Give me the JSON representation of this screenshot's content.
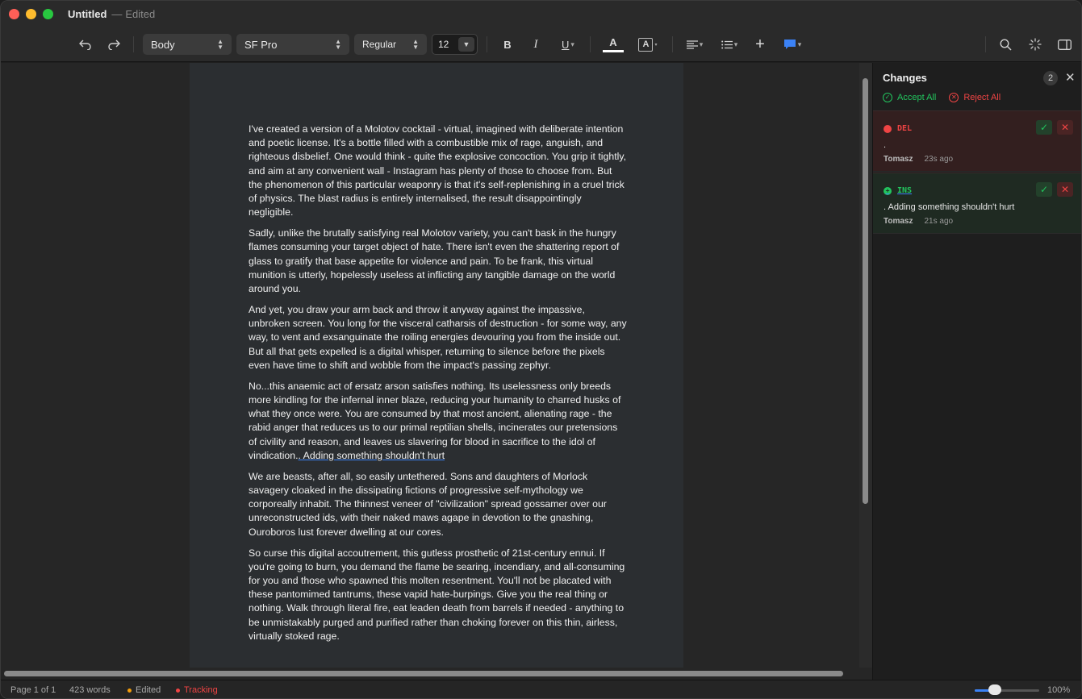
{
  "window": {
    "title": "Untitled",
    "separator": "—",
    "subtitle": "Edited"
  },
  "toolbar": {
    "style_select": "Body",
    "font_select": "SF Pro",
    "weight_select": "Regular",
    "size_value": "12",
    "bold_label": "B",
    "italic_label": "I",
    "underline_label": "U",
    "text_color_label": "A",
    "highlight_label": "A"
  },
  "document": {
    "paragraphs": [
      "I've created a version of a Molotov cocktail - virtual, imagined with deliberate intention and poetic license. It's a bottle filled with a combustible mix of rage, anguish, and righteous disbelief. One would think - quite the explosive concoction. You grip it tightly, and aim at any convenient wall - Instagram has plenty of those to choose from. But the phenomenon of this particular weaponry is that it's self-replenishing in a cruel trick of physics. The blast radius is entirely internalised, the result disappointingly negligible.",
      "Sadly, unlike the brutally satisfying real Molotov variety, you can't bask in the hungry flames consuming your target object of hate. There isn't even the shattering report of glass to gratify that base appetite for violence and pain. To be frank, this virtual munition is utterly, hopelessly useless at inflicting any tangible damage on the world around you.",
      "And yet, you draw your arm back and throw it anyway against the impassive, unbroken screen. You long for the visceral catharsis of destruction - for some way, any way, to vent and exsanguinate the roiling energies devouring you from the inside out. But all that gets expelled is a digital whisper, returning to silence before the pixels even have time to shift and wobble from the impact's passing zephyr.",
      "No...this anaemic act of ersatz arson satisfies nothing. Its uselessness only breeds more kindling for the infernal inner blaze, reducing your humanity to charred husks of what they once were. You are consumed by that most ancient, alienating rage - the rabid anger that reduces us to our primal reptilian shells, incinerates our pretensions of civility and reason, and leaves us slavering for blood in sacrifice to the idol of vindication.",
      "We are beasts, after all, so easily untethered. Sons and daughters of Morlock savagery cloaked in the dissipating fictions of progressive self-mythology we corporeally inhabit. The thinnest veneer of \"civilization\" spread gossamer over our unreconstructed ids, with their naked maws agape in devotion to the gnashing, Ouroboros lust forever dwelling at our cores.",
      "So curse this digital accoutrement, this gutless prosthetic of 21st-century ennui. If you're going to burn, you demand the flame be searing, incendiary, and all-consuming for you and those who spawned this molten resentment. You'll not be placated with these pantomimed tantrums, these vapid hate-burpings. Give you the real thing or nothing. Walk through literal fire, eat leaden death from barrels if needed - anything to be unmistakably purged and purified rather than choking forever on this thin, airless, virtually stoked rage."
    ],
    "inserted_text": ". Adding something shouldn't hurt"
  },
  "sidebar": {
    "title": "Changes",
    "count": "2",
    "close_glyph": "✕",
    "accept_all": "Accept All",
    "reject_all": "Reject All",
    "changes": [
      {
        "kind": "DEL",
        "text": ".",
        "author": "Tomasz",
        "time": "23s ago"
      },
      {
        "kind": "INS",
        "text": ". Adding something shouldn't hurt",
        "author": "Tomasz",
        "time": "21s ago"
      }
    ]
  },
  "status": {
    "page": "Page 1 of 1",
    "words": "423 words",
    "edited": "Edited",
    "tracking": "Tracking",
    "zoom": "100%",
    "zoom_level": 0.3
  },
  "colors": {
    "accept": "#22c55e",
    "reject": "#ef4444",
    "accent": "#3b82f6",
    "edited_dot": "#f59e0b"
  }
}
